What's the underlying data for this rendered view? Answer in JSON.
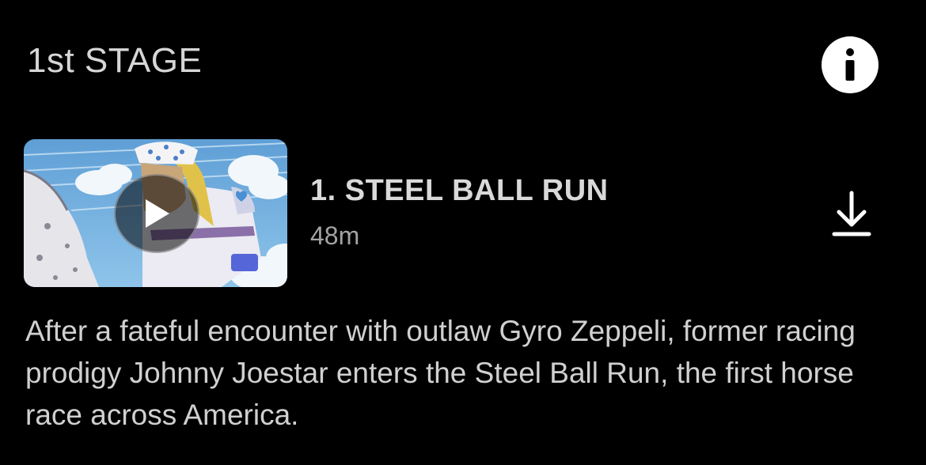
{
  "season": {
    "label": "1st STAGE"
  },
  "icons": {
    "info": "info-icon",
    "play": "play-icon",
    "download": "download-icon"
  },
  "episode": {
    "title": "1. STEEL BALL RUN",
    "duration": "48m",
    "synopsis": "After a fateful encounter with outlaw Gyro Zeppeli, former racing prodigy Johnny Joestar enters the Steel Ball Run, the first horse race across America."
  },
  "colors": {
    "background": "#000000",
    "title_text": "#d9d9d9",
    "meta_text": "#a3a3a3",
    "icon": "#ffffff"
  }
}
